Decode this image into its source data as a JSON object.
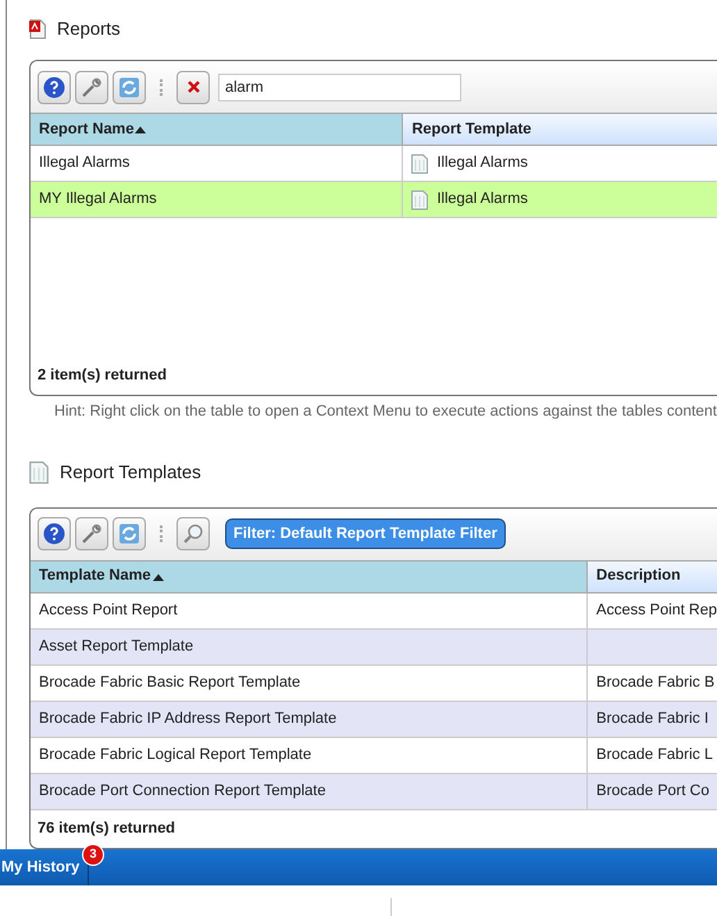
{
  "reports": {
    "title": "Reports",
    "search": {
      "value": "alarm"
    },
    "table": {
      "columns": [
        {
          "label": "Report Name",
          "sorted": true
        },
        {
          "label": "Report Template",
          "sorted": false
        }
      ],
      "rows": [
        {
          "selected": false,
          "cells": [
            "Illegal Alarms",
            "Illegal Alarms"
          ]
        },
        {
          "selected": true,
          "cells": [
            "MY Illegal Alarms",
            "Illegal Alarms"
          ]
        }
      ]
    },
    "footer": "2 item(s) returned",
    "hint": "Hint: Right click on the table to open a Context Menu to execute actions against the tables content"
  },
  "report_templates": {
    "title": "Report Templates",
    "filter_button": "Filter: Default Report Template Filter",
    "table": {
      "columns": [
        {
          "label": "Template Name",
          "sorted": true
        },
        {
          "label": "Description",
          "sorted": false
        }
      ],
      "rows": [
        {
          "selected": false,
          "cells": [
            "Access Point Report",
            "Access Point Rep"
          ]
        },
        {
          "selected": false,
          "cells": [
            "Asset Report Template",
            ""
          ]
        },
        {
          "selected": false,
          "cells": [
            "Brocade Fabric Basic Report Template",
            "Brocade Fabric B"
          ]
        },
        {
          "selected": false,
          "cells": [
            "Brocade Fabric IP Address Report Template",
            "Brocade Fabric I"
          ]
        },
        {
          "selected": false,
          "cells": [
            "Brocade Fabric Logical Report Template",
            "Brocade Fabric L"
          ]
        },
        {
          "selected": false,
          "cells": [
            "Brocade Port Connection Report Template",
            "Brocade Port Co"
          ]
        }
      ]
    },
    "footer": "76 item(s) returned"
  },
  "bottom_bar": {
    "tab": "My History",
    "badge": "3"
  }
}
